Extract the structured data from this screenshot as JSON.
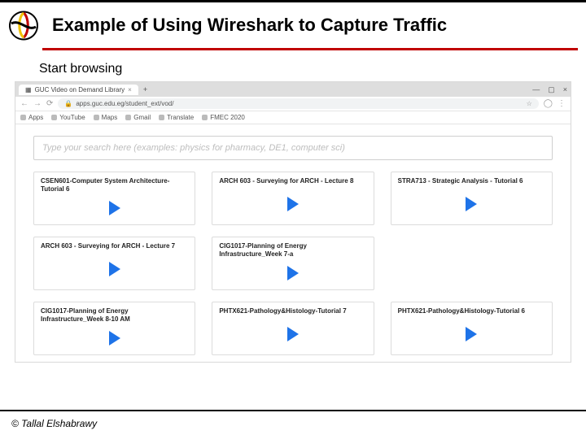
{
  "slide": {
    "title": "Example of Using Wireshark to Capture Traffic",
    "subheading": "Start browsing",
    "footer": "© Tallal Elshabrawy"
  },
  "browser": {
    "tab_title": "GUC Video on Demand Library",
    "tab_close": "×",
    "tab_plus": "+",
    "win_min": "—",
    "win_max": "▢",
    "win_close": "×",
    "nav_back": "←",
    "nav_fwd": "→",
    "nav_reload": "⟳",
    "lock": "🔒",
    "url": "apps.guc.edu.eg/student_ext/vod/",
    "star": "☆",
    "ext": "⋮",
    "avatar": "◯",
    "bookmarks_label": "Apps",
    "bookmarks": [
      {
        "label": "YouTube"
      },
      {
        "label": "Maps"
      },
      {
        "label": "Gmail"
      },
      {
        "label": "Translate"
      },
      {
        "label": "FMEC 2020"
      }
    ]
  },
  "page": {
    "search_placeholder": "Type your search here (examples: physics for pharmacy, DE1, computer sci)",
    "cards": [
      {
        "title": "CSEN601-Computer System Architecture-Tutorial 6"
      },
      {
        "title": "ARCH 603 - Surveying for ARCH - Lecture 8"
      },
      {
        "title": "STRA713 - Strategic Analysis - Tutorial 6"
      },
      {
        "title": "ARCH 603 - Surveying for ARCH - Lecture 7"
      },
      {
        "title": "CIG1017-Planning of Energy Infrastructure_Week 7-a"
      },
      {
        "title": ""
      },
      {
        "title": "CIG1017-Planning of Energy Infrastructure_Week 8-10 AM"
      },
      {
        "title": "PHTX621-Pathology&Histology-Tutorial 7"
      },
      {
        "title": "PHTX621-Pathology&Histology-Tutorial 6"
      }
    ]
  }
}
